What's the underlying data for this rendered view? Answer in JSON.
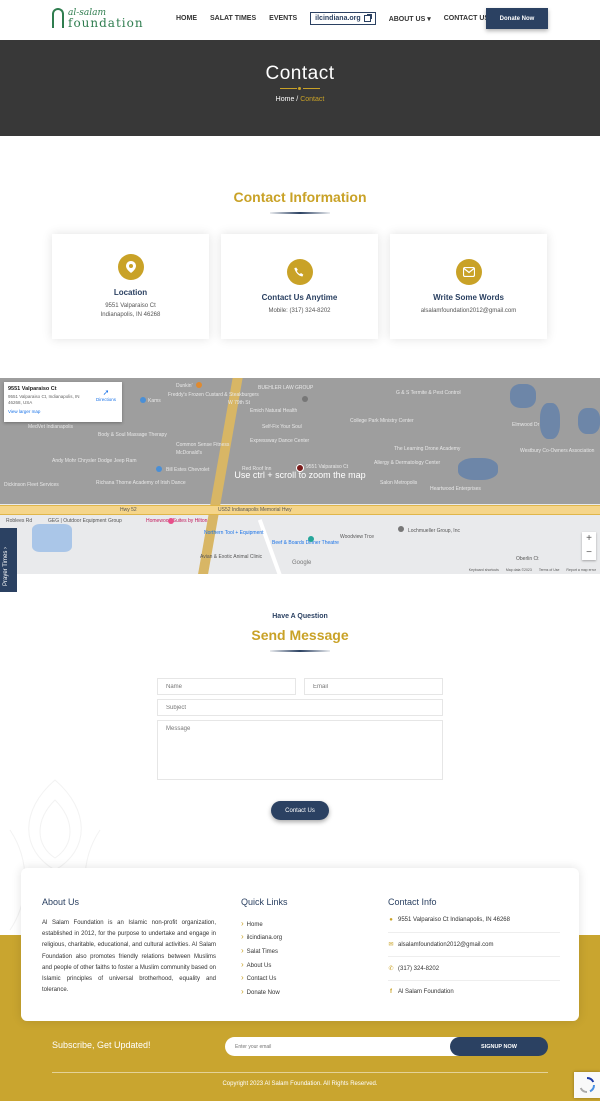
{
  "nav": {
    "logo_line1": "al-salam",
    "logo_line2": "foundation",
    "items": [
      "HOME",
      "SALAT TIMES",
      "EVENTS",
      "ilcindiana.org",
      "ABOUT US",
      "CONTACT US"
    ],
    "donate_label": "Donate Now"
  },
  "hero": {
    "title": "Contact",
    "crumb_home": "Home",
    "crumb_sep": " / ",
    "crumb_current": "Contact"
  },
  "contact_info": {
    "title": "Contact Information",
    "cards": [
      {
        "title": "Location",
        "lines": [
          "9551 Valparaiso Ct",
          "Indianapolis, IN 46268"
        ],
        "icon": "location-pin-icon"
      },
      {
        "title": "Contact Us Anytime",
        "lines": [
          "Mobile: (317) 324-8202"
        ],
        "icon": "phone-icon"
      },
      {
        "title": "Write Some Words",
        "lines": [
          "alsalamfoundation2012@gmail.com"
        ],
        "icon": "envelope-icon"
      }
    ]
  },
  "map": {
    "place_title": "9551 Valparaiso Ct",
    "place_address": "9551 Valparaiso Ct, Indianapolis, IN 46268, USA",
    "larger_map": "View larger map",
    "directions": "Directions",
    "overlay_message": "Use ctrl + scroll to zoom the map",
    "labels": [
      "Dunkin'",
      "BUEHLER LAW GROUP",
      "Kams",
      "Freddy's Frozen Custard & Steakburgers",
      "W 79th St",
      "Emich Natural Health",
      "Self-Fix Your Soul",
      "College Park Ministry Center",
      "G & S Termite & Pest Control",
      "Elmwood Dr",
      "Body & Soul Massage Therapy",
      "MedVet Indianapolis",
      "Common Sense Fitness",
      "Expressway Dance Center",
      "McDonald's",
      "The Learning Drone Academy",
      "Westbury Co-Owners Association",
      "Andy Mohr Chrysler Dodge Jeep Ram",
      "Bill Estes Chevrolet",
      "Red Roof Inn",
      "9551 Valparaiso Ct",
      "Allergy & Dermatology Center",
      "Salon Metropolis",
      "Heartwood Enterprises",
      "Dickinson Fleet Services",
      "Richana Thorne Academy of Irish Dance",
      "Hwy 52",
      "US52 Indianapolis Memorial Hwy",
      "Roblees Rd",
      "GEG | Outdoor Equipment Group",
      "Homewood Suites by Hilton",
      "Northern Tool + Equipment",
      "Lochmueller Group, Inc",
      "Beef & Boards Dinner Theatre",
      "Woodview Trce",
      "Avian & Exotic Animal Clinic",
      "Oberlin Ct"
    ],
    "footer": [
      "Keyboard shortcuts",
      "Map data ©2023",
      "Terms of Use",
      "Report a map error"
    ],
    "zoom_in": "+",
    "zoom_out": "−",
    "google": "Google"
  },
  "prayer_tab": {
    "label": "Prayer Times ›"
  },
  "form": {
    "kicker": "Have A Question",
    "title": "Send Message",
    "name_placeholder": "Name",
    "email_placeholder": "Email",
    "subject_placeholder": "Subject",
    "message_placeholder": "Message",
    "submit_label": "Contact Us"
  },
  "footer": {
    "about_title": "About Us",
    "about_text": "Al Salam Foundation is an Islamic non-profit organization, established in 2012, for the purpose to undertake and engage in religious, charitable, educational, and cultural activities. Al Salam Foundation also promotes friendly relations between Muslims and people of other faiths to foster a Muslim community based on Islamic principles of universal brotherhood, equality and tolerance.",
    "links_title": "Quick Links",
    "links": [
      "Home",
      "ilcindiana.org",
      "Salat Times",
      "About Us",
      "Contact Us",
      "Donate Now"
    ],
    "contact_title": "Contact Info",
    "address": "9551 Valparaiso Ct Indianapolis, IN 46268",
    "email": "alsalamfoundation2012@gmail.com",
    "phone": "(317) 324-8202",
    "facebook": "Al Salam Foundation",
    "subscribe_title": "Subscribe, Get Updated!",
    "subscribe_placeholder": "Enter your email",
    "subscribe_button": "SIGNUP NOW",
    "copyright": "Copyright 2023 Al Salam Foundation. All Rights Reserved."
  },
  "colors": {
    "gold": "#c9a227",
    "navy": "#2b4162",
    "hero_bg": "#383838",
    "footer_gold": "#c9a52f"
  }
}
